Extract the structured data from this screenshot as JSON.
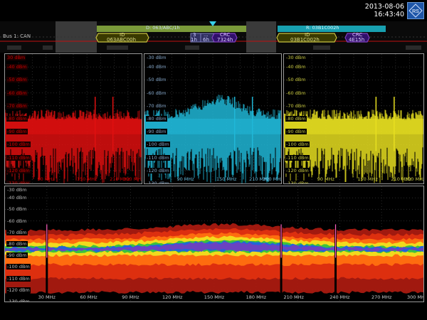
{
  "header": {
    "date": "2013-08-06",
    "time": "16:43:40"
  },
  "bus": {
    "label": "Bus 1: CAN",
    "frames": [
      {
        "title": "D: 063/ABC/1h",
        "id_label": "ID",
        "id_value": "063ABC00h",
        "field_a": "3",
        "field_b": "1h",
        "field_c": "6h",
        "field_d": "...",
        "crc_label": "CRC",
        "crc_value": "7324h"
      },
      {
        "title": "R: 03B1C002h",
        "id_label": "ID",
        "id_value": "03B1C002h",
        "crc_label": "CRC",
        "crc_value": "4E15h"
      }
    ]
  },
  "panels": {
    "red": {
      "y_ticks": [
        "30 dBm",
        "-40 dBm",
        "-50 dBm",
        "-60 dBm",
        "-70 dBm",
        "-80 dBm",
        "-90 dBm",
        "-100 dBm",
        "-110 dBm",
        "-120 dBm",
        "-130 dBm"
      ],
      "x_ticks": [
        "90 MHz",
        "150 MHz",
        "210 MHz",
        "300 MHz"
      ]
    },
    "cyan": {
      "y_ticks": [
        "-30 dBm",
        "-40 dBm",
        "-50 dBm",
        "-60 dBm",
        "-70 dBm",
        "-80 dBm",
        "-90 dBm",
        "-100 dBm",
        "-110 dBm",
        "-120 dBm",
        "-130 dBm"
      ],
      "x_ticks": [
        "90 MHz",
        "150 MHz",
        "210 MHz",
        "300 MHz"
      ]
    },
    "yellow": {
      "y_ticks": [
        "-30 dBm",
        "-40 dBm",
        "-50 dBm",
        "-60 dBm",
        "-70 dBm",
        "-80 dBm",
        "-90 dBm",
        "-100 dBm",
        "-110 dBm",
        "-120 dBm",
        "-130 dBm"
      ],
      "x_ticks": [
        "90 MHz",
        "150 MHz",
        "210 MHz",
        "300 MHz"
      ]
    },
    "bottom": {
      "y_ticks": [
        "-30 dBm",
        "-40 dBm",
        "-50 dBm",
        "-60 dBm",
        "-70 dBm",
        "-80 dBm",
        "-90 dBm",
        "-100 dBm",
        "-110 dBm",
        "-120 dBm",
        "-130 dBm"
      ],
      "x_ticks": [
        "30 MHz",
        "60 MHz",
        "90 MHz",
        "120 MHz",
        "150 MHz",
        "180 MHz",
        "210 MHz",
        "240 MHz",
        "270 MHz",
        "300 MHz"
      ]
    }
  },
  "colors": {
    "red": "#e01010",
    "cyan": "#20b8d8",
    "yellow": "#e8e020",
    "frame_green": "#7a9a3a",
    "frame_cyan": "#18a0b0",
    "id_yellow": "#c8c040",
    "crc_purple": "#8040c0"
  },
  "icons": {
    "logo": "rs-logo-icon",
    "trigger": "trigger-marker-icon"
  }
}
